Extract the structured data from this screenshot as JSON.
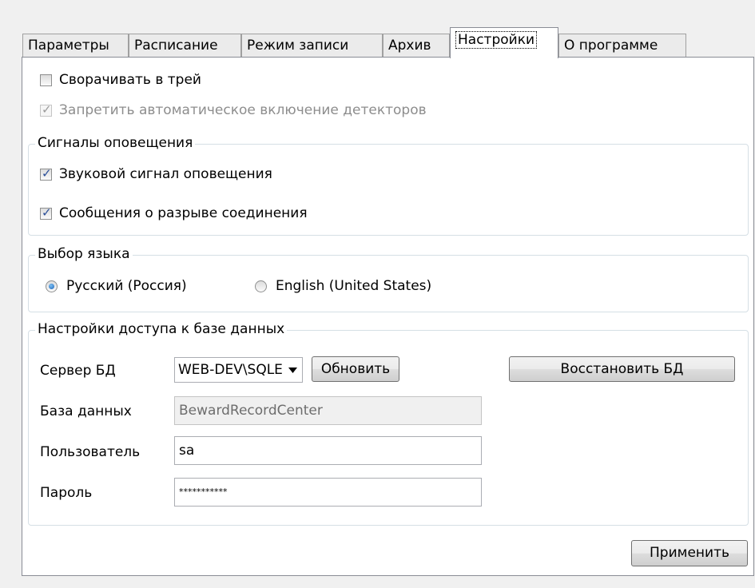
{
  "tabs": [
    {
      "label": "Параметры"
    },
    {
      "label": "Расписание"
    },
    {
      "label": "Режим записи"
    },
    {
      "label": "Архив"
    },
    {
      "label": "Настройки"
    },
    {
      "label": "О программе"
    }
  ],
  "general": {
    "minimize_tray": {
      "label": "Сворачивать в трей",
      "checked": false
    },
    "disable_detectors": {
      "label": "Запретить автоматическое включение детекторов",
      "checked": true,
      "disabled": true
    }
  },
  "alerts": {
    "title": "Сигналы оповещения",
    "sound": {
      "label": "Звуковой сигнал оповещения",
      "checked": true
    },
    "disconnect": {
      "label": "Сообщения о разрыве соединения",
      "checked": true
    }
  },
  "language": {
    "title": "Выбор языка",
    "options": [
      {
        "label": "Русский (Россия)",
        "selected": true
      },
      {
        "label": "English (United States)",
        "selected": false
      }
    ]
  },
  "db": {
    "title": "Настройки доступа к базе данных",
    "server_label": "Сервер БД",
    "server_value": "WEB-DEV\\SQLEXPRESS",
    "refresh_button": "Обновить",
    "restore_button": "Восстановить БД",
    "database_label": "База данных",
    "database_value": "BewardRecordCenter",
    "user_label": "Пользователь",
    "user_value": "sa",
    "password_label": "Пароль",
    "password_value": "***********"
  },
  "apply_button": "Применить",
  "icons": {
    "dropdown": "chevron-down-icon",
    "check": "check-icon"
  }
}
